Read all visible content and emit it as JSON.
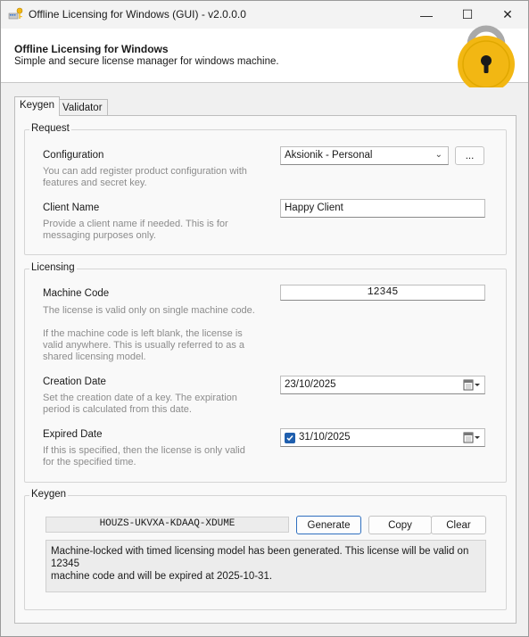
{
  "window": {
    "title": "Offline Licensing for Windows (GUI) - v2.0.0.0",
    "minimize": "—",
    "maximize": "☐",
    "close": "✕"
  },
  "header": {
    "title": "Offline Licensing for Windows",
    "subtitle": "Simple and secure license manager for windows machine."
  },
  "tabs": [
    {
      "label": "Keygen",
      "selected": true
    },
    {
      "label": "Validator",
      "selected": false
    }
  ],
  "request": {
    "group_label": "Request",
    "configuration": {
      "label": "Configuration",
      "description_1": "You can add register product configuration with",
      "description_2": "features and secret key.",
      "selected_value": "Aksionik - Personal",
      "browse_label": "..."
    },
    "client_name": {
      "label": "Client Name",
      "description_1": "Provide a client name if needed. This is for",
      "description_2": "messaging purposes only.",
      "value": "Happy Client"
    }
  },
  "licensing": {
    "group_label": "Licensing",
    "machine_code": {
      "label": "Machine Code",
      "description_1": "The license is valid only on single machine code.",
      "description_2": "If the machine code is left blank, the license is",
      "description_3": "valid anywhere. This is usually referred to as a",
      "description_4": "shared licensing model.",
      "value": "12345"
    },
    "creation_date": {
      "label": "Creation Date",
      "description_1": "Set the creation date of a key. The expiration",
      "description_2": "period is calculated from this date.",
      "value": "23/10/2025"
    },
    "expired_date": {
      "label": "Expired Date",
      "description_1": "If this is specified, then the license is only valid",
      "description_2": "for the specified time.",
      "checked": true,
      "value": "31/10/2025"
    }
  },
  "keygen": {
    "group_label": "Keygen",
    "license_key": "HOUZS-UKVXA-KDAAQ-XDUME",
    "generate_label": "Generate",
    "copy_label": "Copy",
    "clear_label": "Clear",
    "output_line_1": "Machine-locked with timed licensing model has been generated. This license will be valid on 12345",
    "output_line_2": "machine code and will be expired at 2025-10-31."
  },
  "colors": {
    "accent": "#1f5fae",
    "lock_gold": "#f2b713",
    "lock_ring": "#a9a9a9"
  }
}
